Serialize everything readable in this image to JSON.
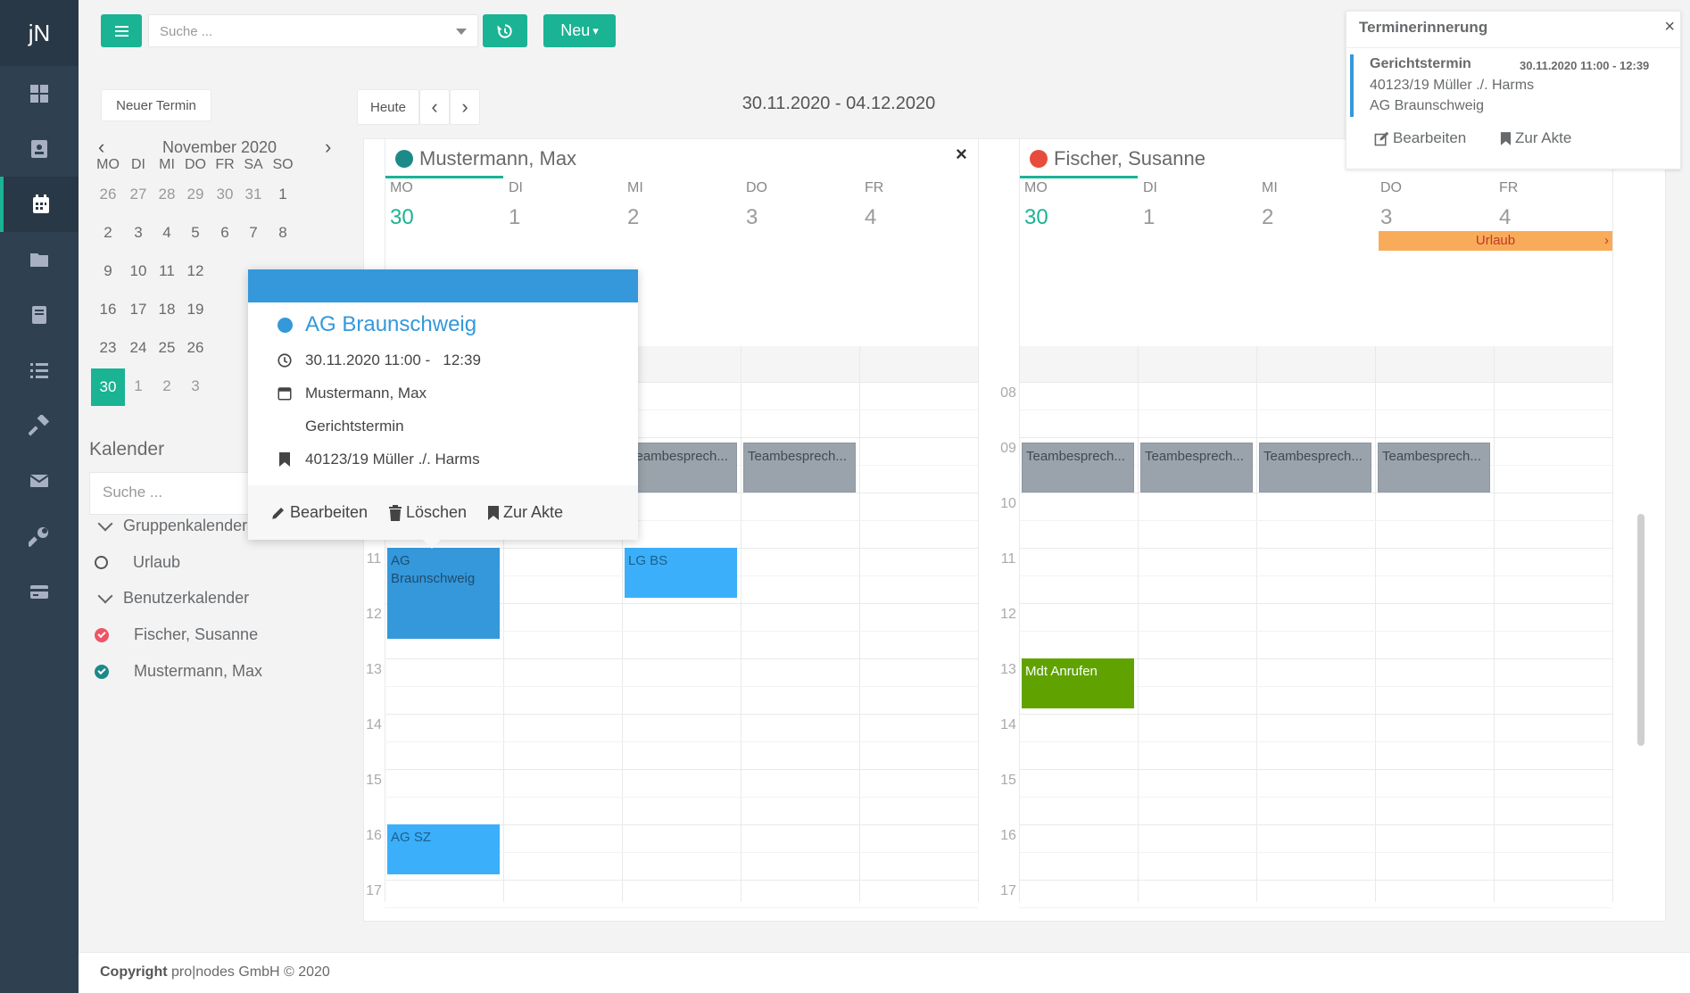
{
  "app": {
    "logo": "jN",
    "nav_icons": [
      "dashboard-icon",
      "contacts-icon",
      "calendar-icon",
      "folder-icon",
      "files-icon",
      "tasks-icon",
      "hammer-icon",
      "mail-icon",
      "wrench-icon",
      "billing-icon"
    ],
    "active_nav": "calendar-icon"
  },
  "toolbar": {
    "search_placeholder": "Suche ...",
    "new_label": "Neu",
    "new_caret": "▾"
  },
  "calendar_controls": {
    "new_appointment": "Neuer Termin",
    "today": "Heute",
    "prev": "‹",
    "next": "›",
    "range": "30.11.2020 - 04.12.2020"
  },
  "mini_calendar": {
    "month": "November 2020",
    "prev": "‹",
    "next": "›",
    "weekdays": [
      "MO",
      "DI",
      "MI",
      "DO",
      "FR",
      "SA",
      "SO"
    ],
    "weeks": [
      [
        "26",
        "27",
        "28",
        "29",
        "30",
        "31",
        "1"
      ],
      [
        "2",
        "3",
        "4",
        "5",
        "6",
        "7",
        "8"
      ],
      [
        "9",
        "10",
        "11",
        "12",
        "",
        "",
        ""
      ],
      [
        "16",
        "17",
        "18",
        "19",
        "",
        "",
        ""
      ],
      [
        "23",
        "24",
        "25",
        "26",
        "",
        "",
        ""
      ],
      [
        "30",
        "1",
        "2",
        "3",
        "",
        "",
        ""
      ]
    ],
    "today": "30"
  },
  "sidebar": {
    "title": "Kalender",
    "search_placeholder": "Suche ...",
    "group_header": "Gruppenkalender",
    "group_items": [
      "Urlaub"
    ],
    "user_header": "Benutzerkalender",
    "user_items": [
      {
        "name": "Fischer, Susanne",
        "color": "#ed5565"
      },
      {
        "name": "Mustermann, Max",
        "color": "#1c84c6"
      }
    ]
  },
  "resources": [
    {
      "name": "Mustermann, Max",
      "color": "#1c8a88",
      "close": "×",
      "days": [
        {
          "dow": "MO",
          "num": "30"
        },
        {
          "dow": "DI",
          "num": "1"
        },
        {
          "dow": "MI",
          "num": "2"
        },
        {
          "dow": "DO",
          "num": "3"
        },
        {
          "dow": "FR",
          "num": "4"
        }
      ],
      "hours": [
        "08",
        "09",
        "10",
        "11",
        "12",
        "13",
        "14",
        "15",
        "16",
        "17"
      ],
      "events": [
        {
          "title": "Teambesprech...",
          "day": 2,
          "start": 9.1,
          "end": 10.0,
          "style": "gray"
        },
        {
          "title": "Teambesprech...",
          "day": 3,
          "start": 9.1,
          "end": 10.0,
          "style": "gray"
        },
        {
          "title": "AG Braunschweig",
          "day": 0,
          "start": 11.0,
          "end": 12.65,
          "style": "darkblue"
        },
        {
          "title": "LG BS",
          "day": 2,
          "start": 11.0,
          "end": 11.9,
          "style": "blue"
        },
        {
          "title": "AG SZ",
          "day": 0,
          "start": 16.0,
          "end": 16.9,
          "style": "blue"
        }
      ]
    },
    {
      "name": "Fischer, Susanne",
      "color": "#e74c3c",
      "days": [
        {
          "dow": "MO",
          "num": "30"
        },
        {
          "dow": "DI",
          "num": "1"
        },
        {
          "dow": "MI",
          "num": "2"
        },
        {
          "dow": "DO",
          "num": "3"
        },
        {
          "dow": "FR",
          "num": "4"
        }
      ],
      "hours": [
        "08",
        "09",
        "10",
        "11",
        "12",
        "13",
        "14",
        "15",
        "16",
        "17"
      ],
      "allday": {
        "title": "Urlaub",
        "from_day": 3,
        "to_day": 4,
        "color": "#f8ac59",
        "arrow": "›"
      },
      "events": [
        {
          "title": "Teambesprech...",
          "day": 0,
          "start": 9.1,
          "end": 10.0,
          "style": "gray"
        },
        {
          "title": "Teambesprech...",
          "day": 1,
          "start": 9.1,
          "end": 10.0,
          "style": "gray"
        },
        {
          "title": "Teambesprech...",
          "day": 2,
          "start": 9.1,
          "end": 10.0,
          "style": "gray"
        },
        {
          "title": "Teambesprech...",
          "day": 3,
          "start": 9.1,
          "end": 10.0,
          "style": "gray"
        },
        {
          "title": "Mdt Anrufen",
          "day": 0,
          "start": 13.0,
          "end": 13.9,
          "style": "green"
        }
      ]
    }
  ],
  "popover": {
    "title": "AG Braunschweig",
    "color": "#3498db",
    "time": "30.11.2020 11:00 -   12:39",
    "person": "Mustermann, Max",
    "type": "Gerichtstermin",
    "file": "40123/19 Müller ./. Harms",
    "edit": "Bearbeiten",
    "delete": "Löschen",
    "to_file": "Zur Akte"
  },
  "notification": {
    "header": "Terminerinnerung",
    "close": "×",
    "title": "Gerichtstermin",
    "time": "30.11.2020 11:00 - 12:39",
    "file": "40123/19 Müller ./. Harms",
    "court": "AG Braunschweig",
    "edit": "Bearbeiten",
    "to_file": "Zur Akte"
  },
  "footer": {
    "copyright": "Copyright",
    "company": "pro|nodes GmbH © 2020"
  }
}
